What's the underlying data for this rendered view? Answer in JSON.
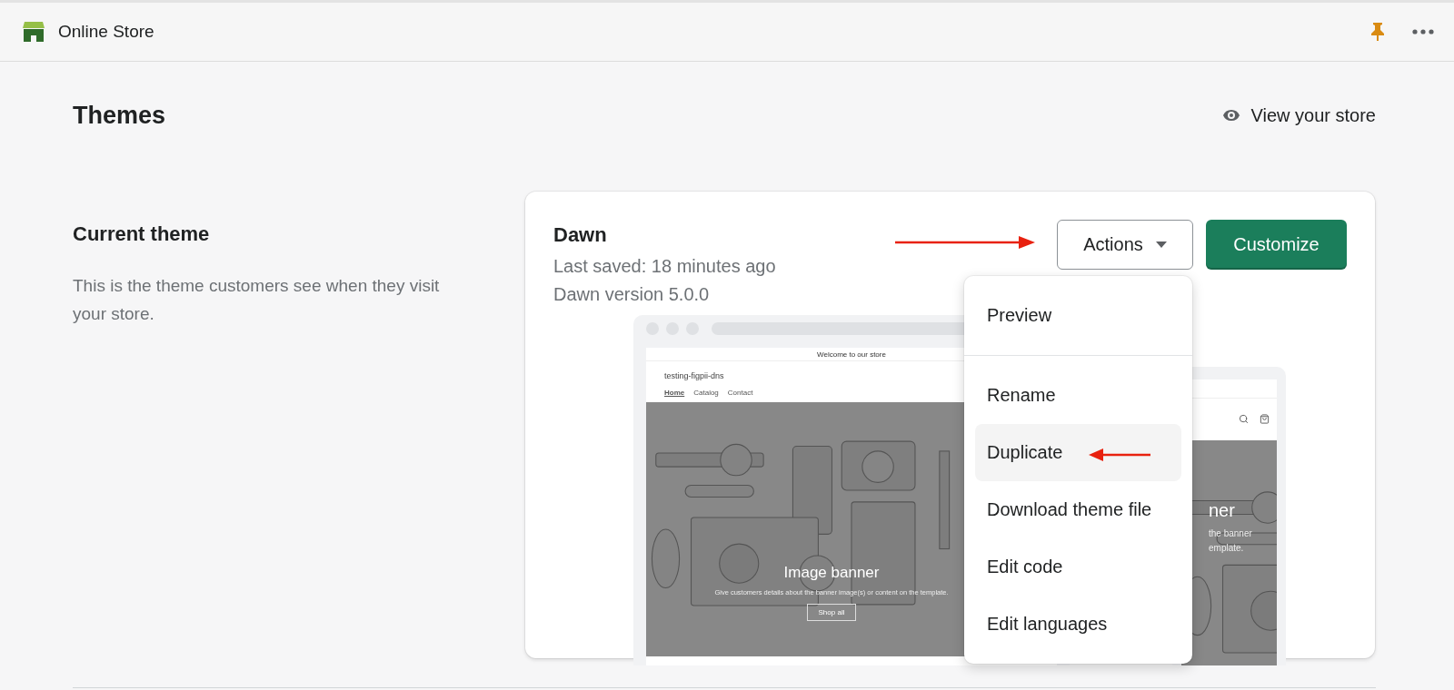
{
  "app": {
    "title": "Online Store"
  },
  "page": {
    "title": "Themes",
    "view_store_link": "View your store"
  },
  "current_theme": {
    "heading": "Current theme",
    "description": "This is the theme customers see when they visit your store."
  },
  "theme": {
    "name": "Dawn",
    "last_saved": "Last saved: 18 minutes ago",
    "version": "Dawn version 5.0.0",
    "actions_button": "Actions",
    "actions_expanded": true,
    "customize_button": "Customize"
  },
  "actions_menu": {
    "sections": [
      [
        {
          "label": "Preview",
          "selected": false
        }
      ],
      [
        {
          "label": "Rename",
          "selected": false
        },
        {
          "label": "Duplicate",
          "selected": true
        },
        {
          "label": "Download theme file",
          "selected": false
        },
        {
          "label": "Edit code",
          "selected": false
        },
        {
          "label": "Edit languages",
          "selected": false
        }
      ]
    ]
  },
  "preview": {
    "desktop": {
      "announcement": "Welcome to our store",
      "store_name": "testing-figpii-dns",
      "nav": [
        {
          "label": "Home",
          "selected": true
        },
        {
          "label": "Catalog",
          "selected": false
        },
        {
          "label": "Contact",
          "selected": false
        }
      ],
      "banner_title": "Image banner",
      "banner_text": "Give customers details about the banner image(s) or content on the template.",
      "banner_button": "Shop all"
    },
    "mobile": {
      "banner_title": "ner",
      "banner_text": [
        "the banner",
        "emplate."
      ]
    }
  }
}
